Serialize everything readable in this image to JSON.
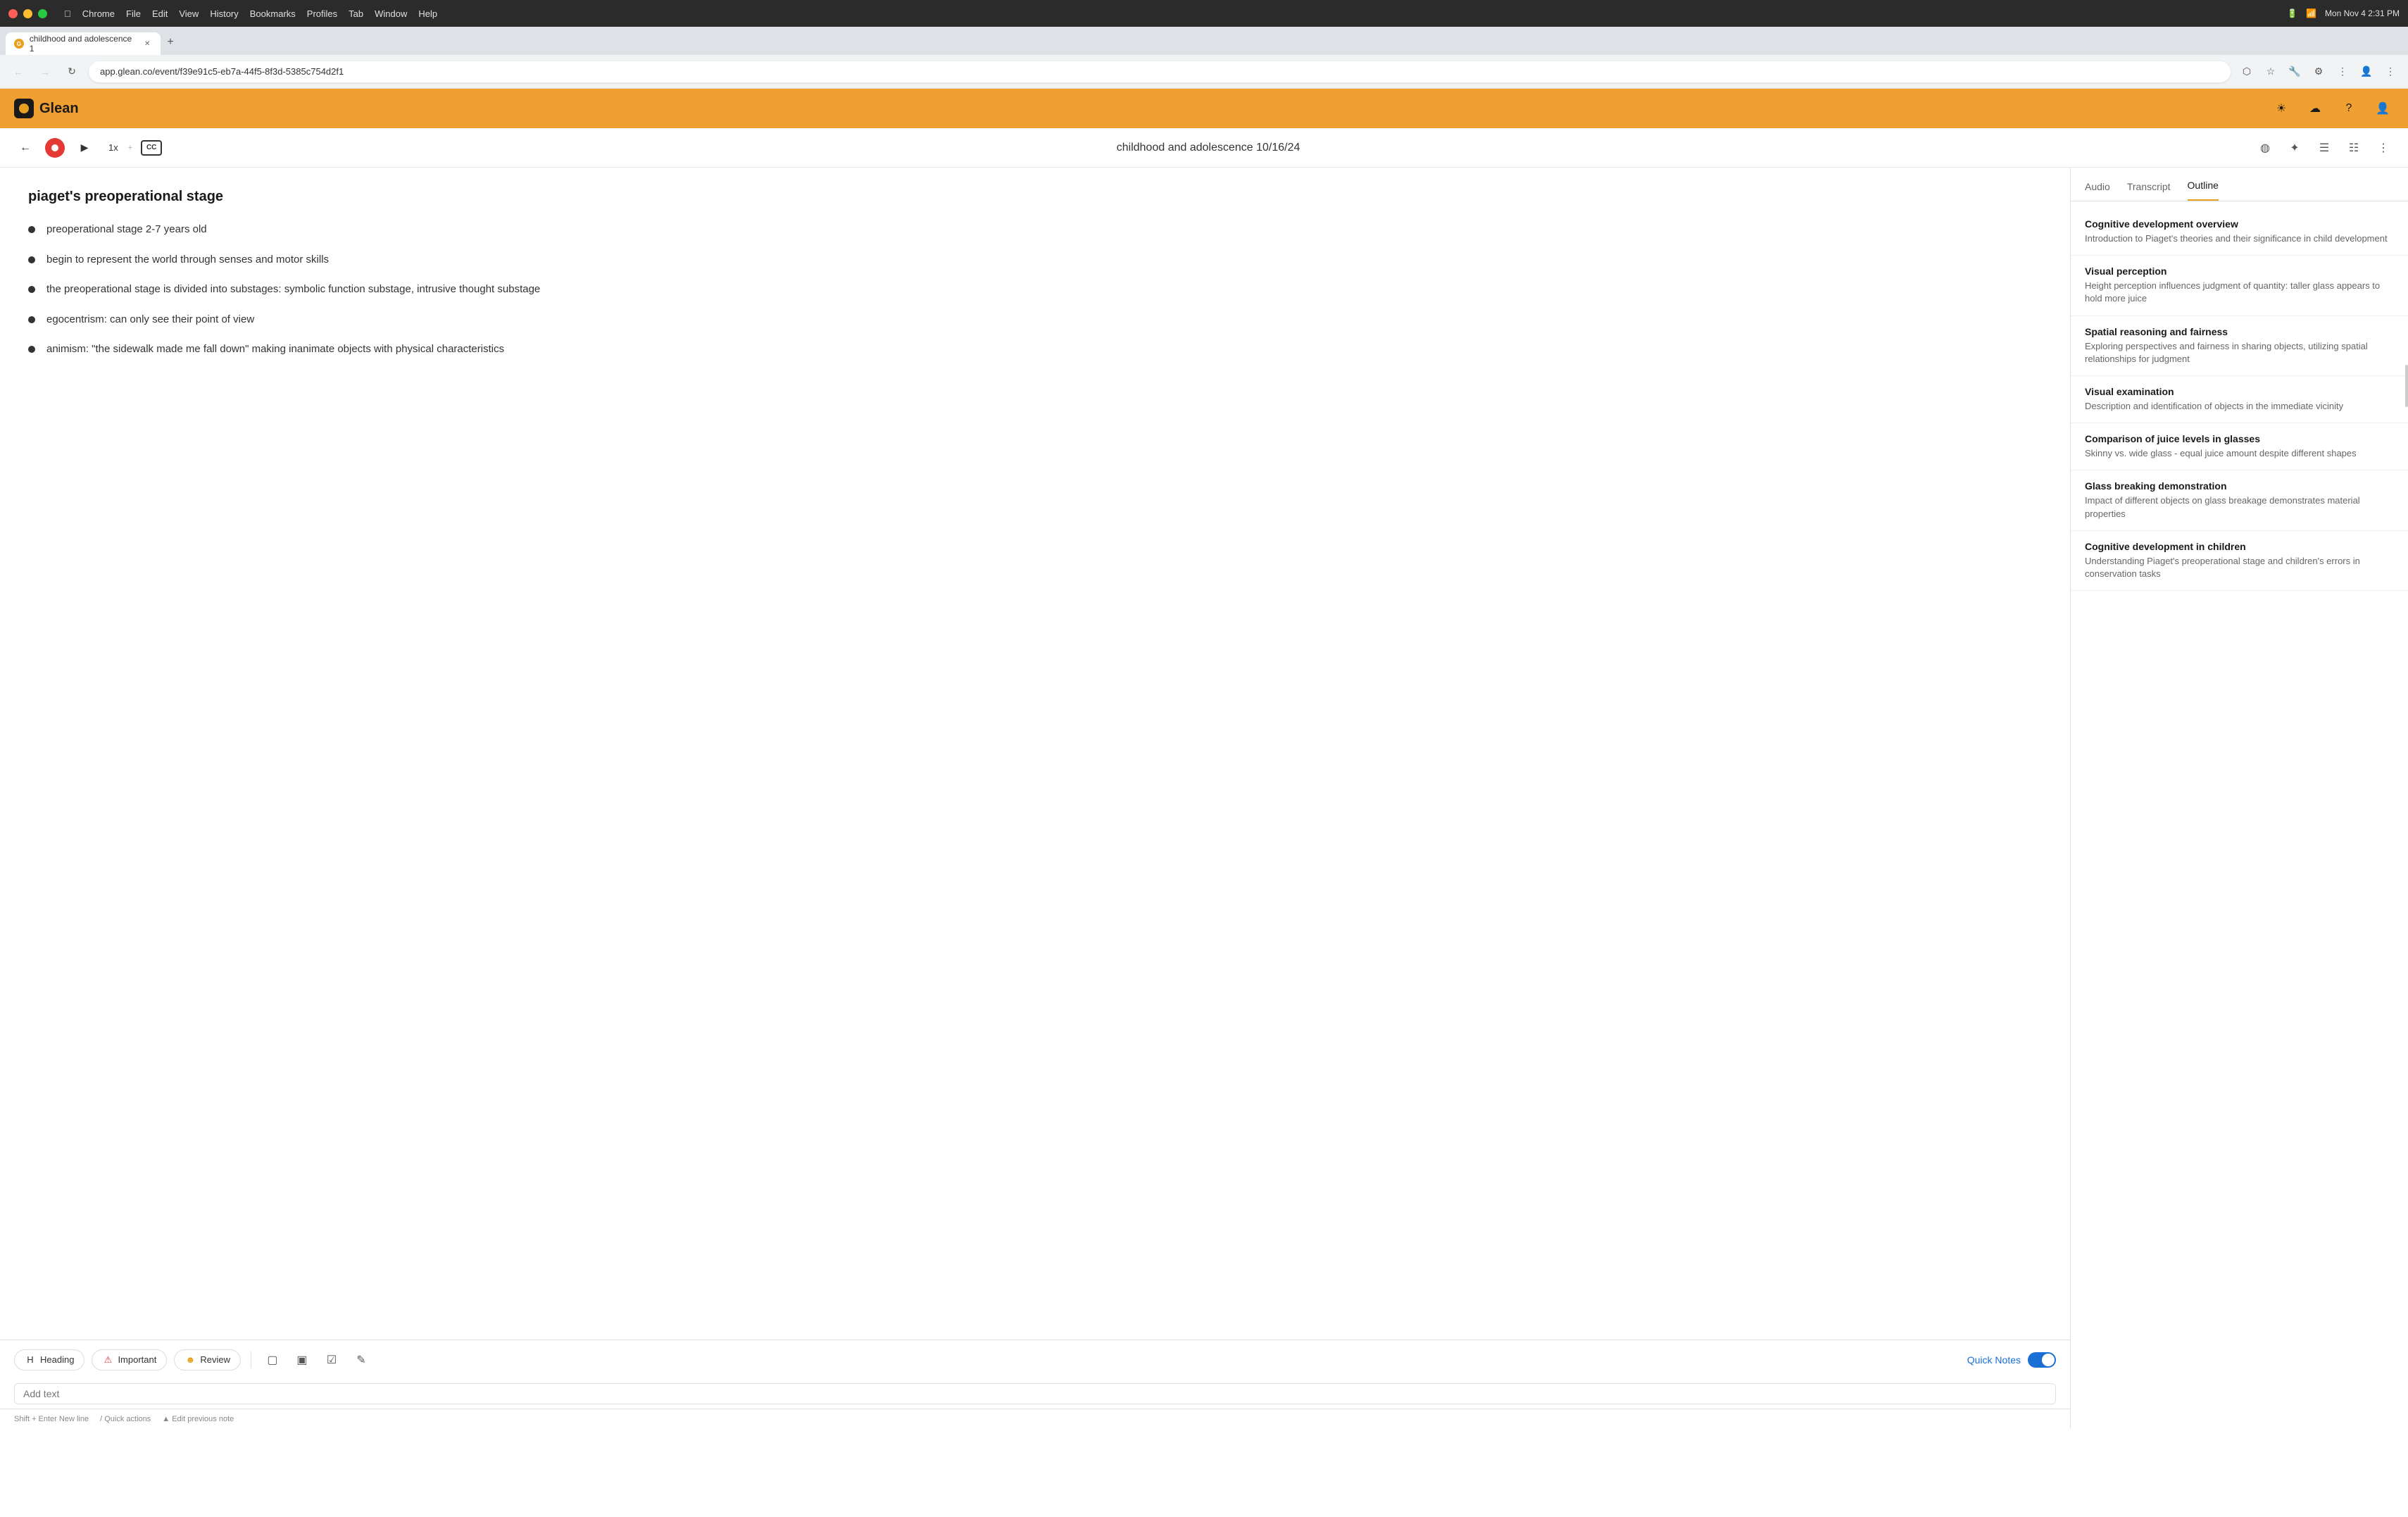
{
  "titlebar": {
    "traffic_lights": [
      "red",
      "yellow",
      "green"
    ],
    "menu_items": [
      "Apple",
      "Chrome",
      "File",
      "Edit",
      "View",
      "History",
      "Bookmarks",
      "Profiles",
      "Tab",
      "Window",
      "Help"
    ],
    "time": "Mon Nov 4  2:31 PM"
  },
  "tabs": {
    "items": [
      {
        "label": "childhood and adolescence 1",
        "active": true
      }
    ],
    "new_tab_label": "+"
  },
  "address_bar": {
    "url": "app.glean.co/event/f39e91c5-eb7a-44f5-8f3d-5385c754d2f1"
  },
  "glean_header": {
    "logo_text": "Glean",
    "icons": [
      "sun",
      "cloud",
      "question",
      "user"
    ]
  },
  "player": {
    "title": "childhood and adolescence 10/16/24",
    "speed": "1x",
    "icons": [
      "history",
      "magic",
      "notes",
      "layout",
      "more"
    ]
  },
  "notes": {
    "section_title": "piaget's preoperational stage",
    "items": [
      {
        "text": "preoperational stage 2-7 years old"
      },
      {
        "text": "begin to represent the world through senses and motor skills"
      },
      {
        "text": "the preoperational stage is divided into substages: symbolic function substage, intrusive thought substage"
      },
      {
        "text": "egocentrism: can only see their point of view"
      },
      {
        "text": "animism: \"the sidewalk made me fall down\" making inanimate objects with physical characteristics"
      }
    ]
  },
  "outline_panel": {
    "tabs": [
      "Audio",
      "Transcript",
      "Outline"
    ],
    "active_tab": "Outline",
    "items": [
      {
        "title": "Cognitive development overview",
        "desc": "Introduction to Piaget's theories and their significance in child development"
      },
      {
        "title": "Visual perception",
        "desc": "Height perception influences judgment of quantity: taller glass appears to hold more juice"
      },
      {
        "title": "Spatial reasoning and fairness",
        "desc": "Exploring perspectives and fairness in sharing objects, utilizing spatial relationships for judgment"
      },
      {
        "title": "Visual examination",
        "desc": "Description and identification of objects in the immediate vicinity"
      },
      {
        "title": "Comparison of juice levels in glasses",
        "desc": "Skinny vs. wide glass - equal juice amount despite different shapes"
      },
      {
        "title": "Glass breaking demonstration",
        "desc": "Impact of different objects on glass breakage demonstrates material properties"
      },
      {
        "title": "Cognitive development in children",
        "desc": "Understanding Piaget's preoperational stage and children's errors in conservation tasks"
      }
    ]
  },
  "toolbar": {
    "heading_label": "Heading",
    "important_label": "Important",
    "review_label": "Review",
    "quick_notes_label": "Quick Notes"
  },
  "editor": {
    "placeholder": "Add text",
    "hints": [
      {
        "key": "Shift + Enter",
        "label": "New line"
      },
      {
        "key": "/",
        "label": "Quick actions"
      },
      {
        "key": "▲",
        "label": "Edit previous note"
      }
    ]
  }
}
